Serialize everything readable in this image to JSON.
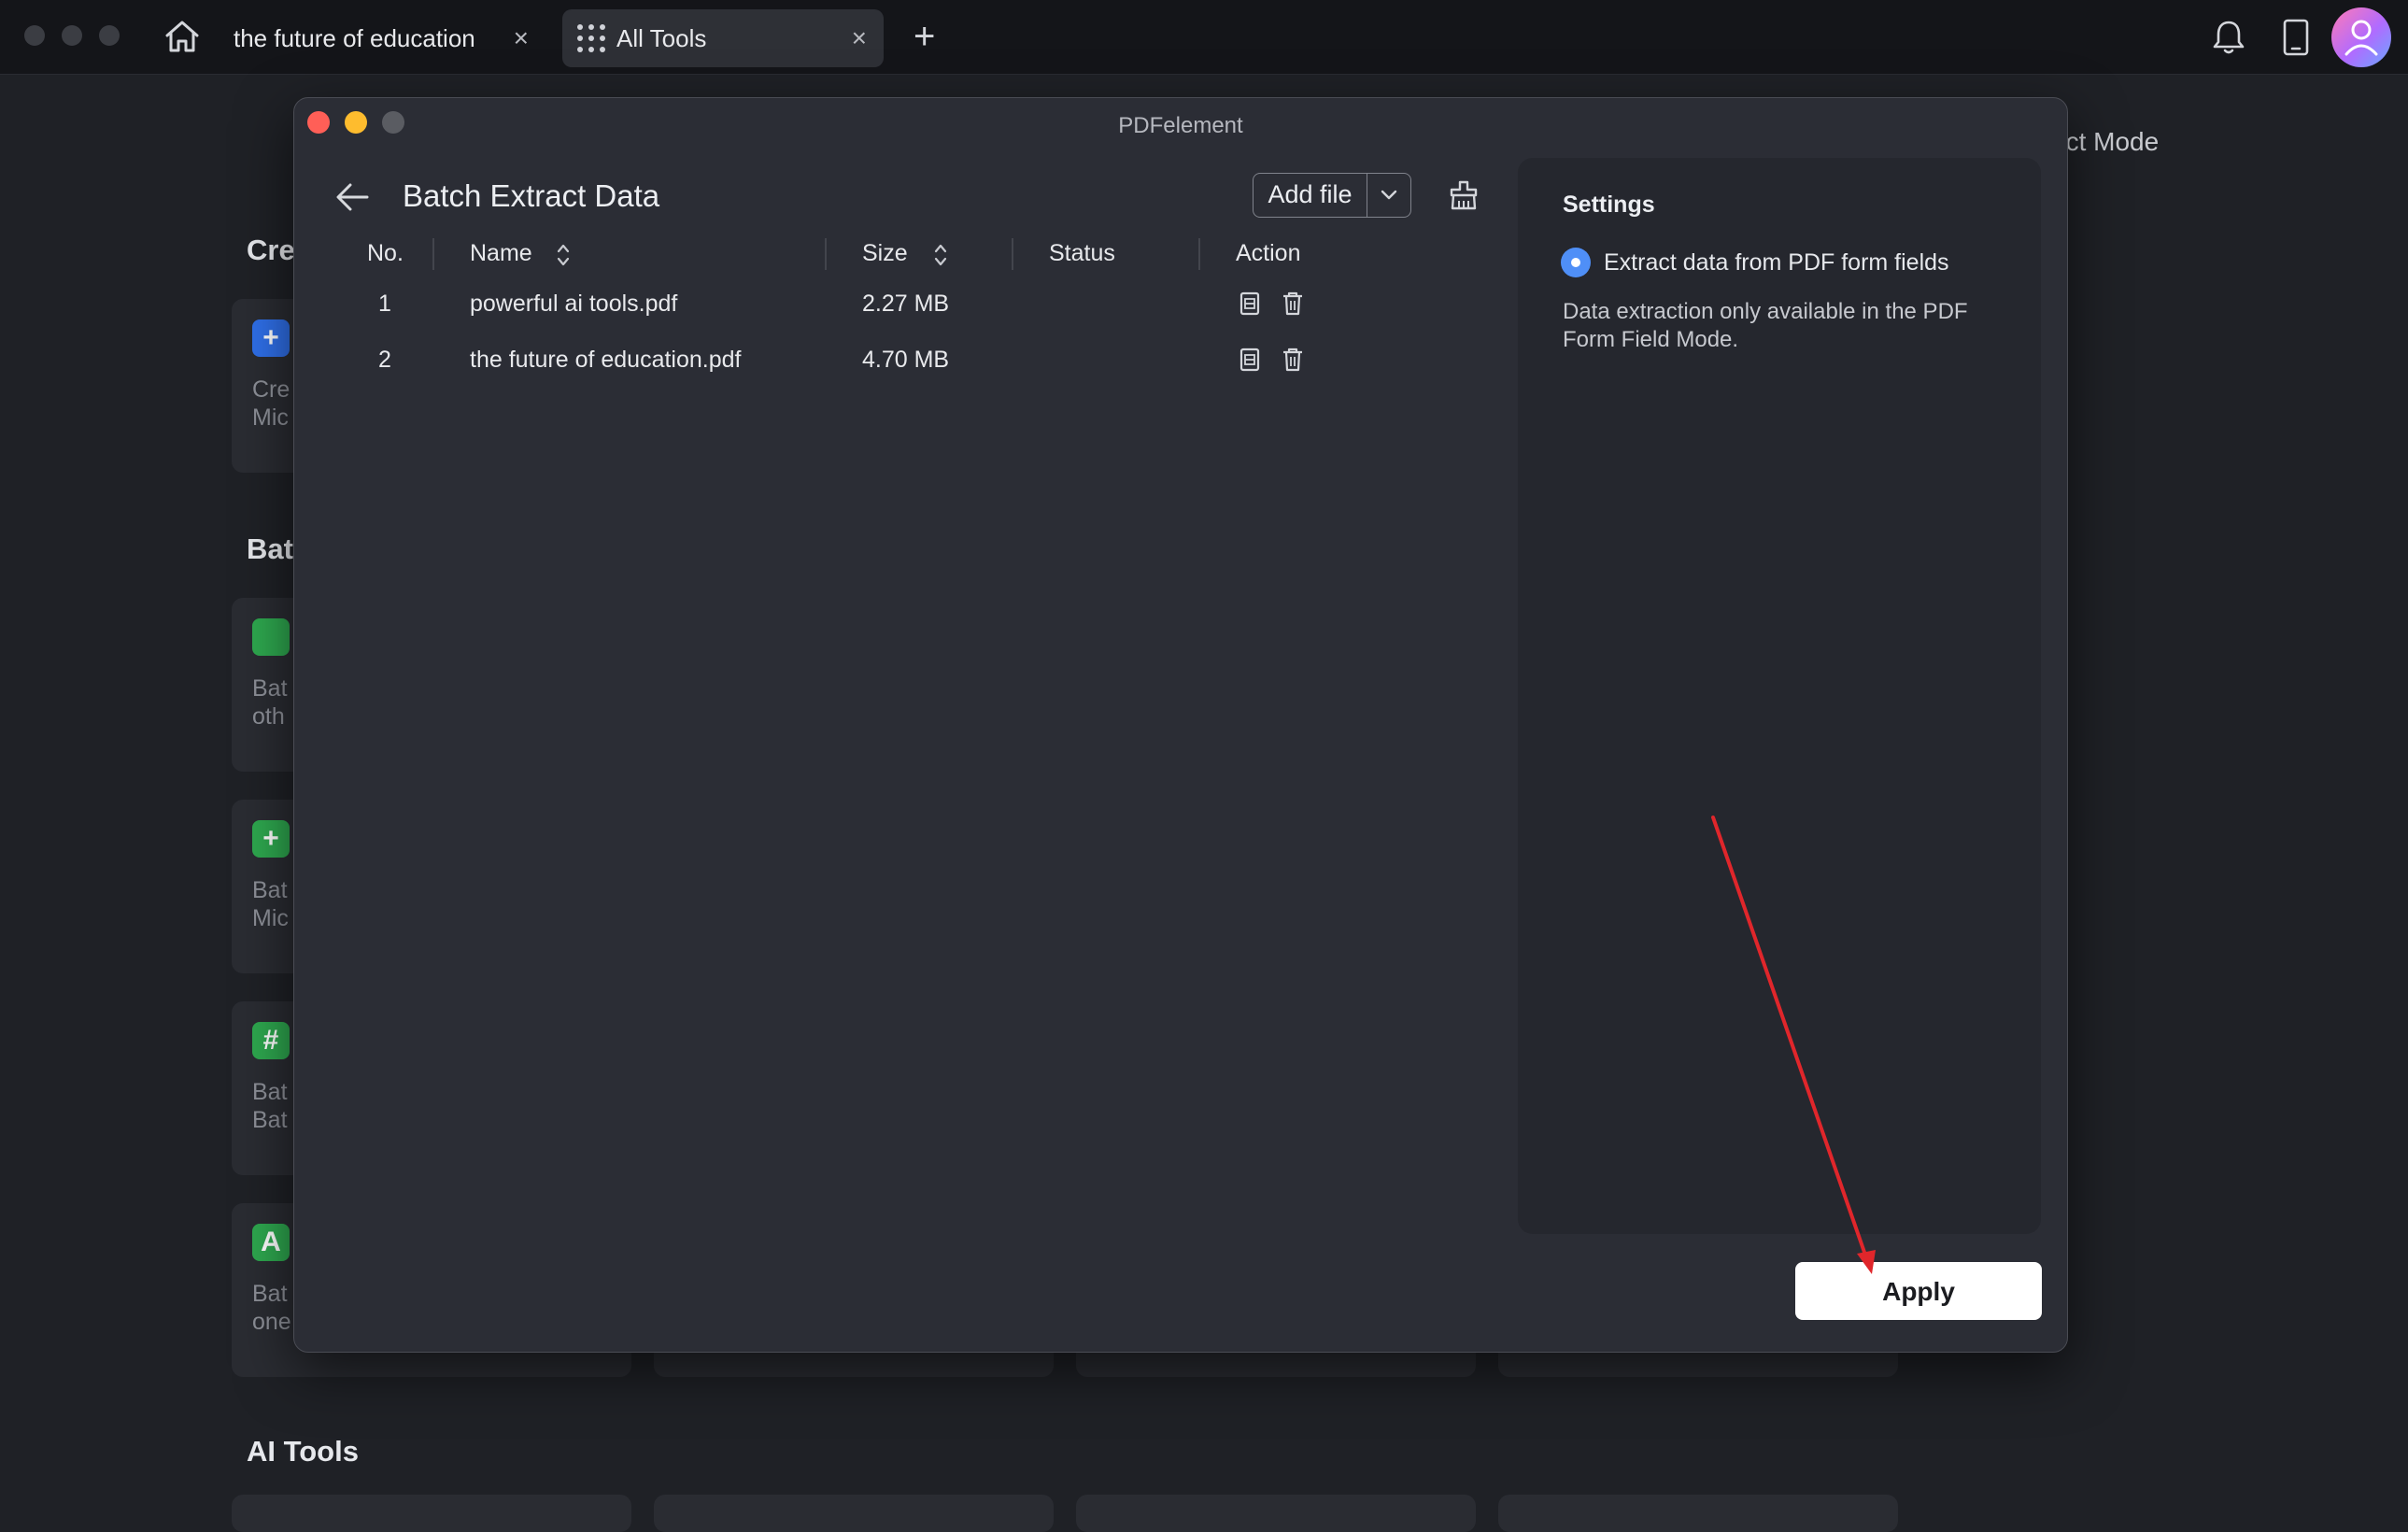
{
  "titlebar": {
    "tabs": [
      {
        "label": "the future of education",
        "close": "×"
      },
      {
        "label": "All Tools",
        "close": "×"
      }
    ],
    "new_tab": "+"
  },
  "background": {
    "select_mode": "ect Mode",
    "sections": {
      "create": "Cre",
      "batch": "Bat",
      "ai_tools": "AI Tools"
    },
    "cards": [
      {
        "icon": "+",
        "line1": "Cre",
        "line2": "Mic"
      },
      {
        "icon": "",
        "line1": "Bat",
        "line2": "oth"
      },
      {
        "icon": "+",
        "line1": "Bat",
        "line2": "Mic"
      },
      {
        "icon": "#",
        "line1": "Bat",
        "line2": "Bat"
      },
      {
        "icon": "A",
        "line1": "Bat",
        "line2": "one"
      }
    ]
  },
  "modal": {
    "window_title": "PDFelement",
    "heading": "Batch Extract Data",
    "add_file": "Add file",
    "table": {
      "headers": {
        "no": "No.",
        "name": "Name",
        "size": "Size",
        "status": "Status",
        "action": "Action"
      },
      "rows": [
        {
          "no": "1",
          "name": "powerful ai tools.pdf",
          "size": "2.27 MB",
          "status": ""
        },
        {
          "no": "2",
          "name": "the future of education.pdf",
          "size": "4.70 MB",
          "status": ""
        }
      ]
    },
    "settings": {
      "title": "Settings",
      "option": "Extract data from PDF form fields",
      "note": "Data extraction only available in the PDF Form Field Mode."
    },
    "apply": "Apply"
  },
  "colors": {
    "accent": "#4f8ff7",
    "annotation_arrow": "#e0262b",
    "apply_bg": "#ffffff"
  }
}
